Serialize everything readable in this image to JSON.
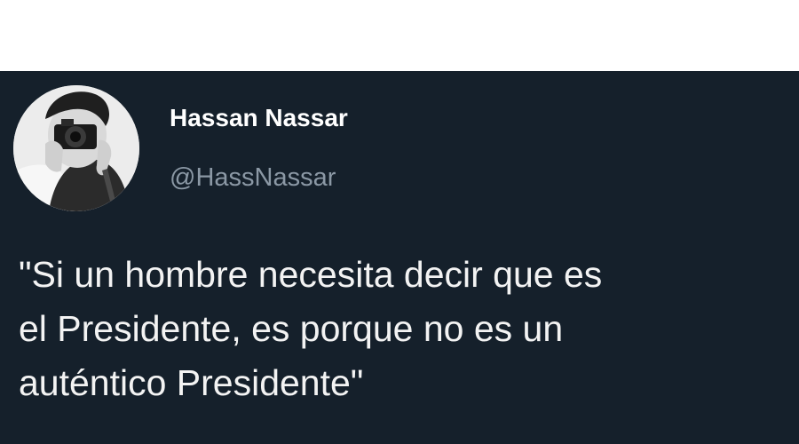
{
  "tweet": {
    "author_name": "Hassan Nassar",
    "author_handle": "@HassNassar",
    "text_lines": [
      "\"Si un hombre necesita decir que es",
      "el Presidente, es porque no es un",
      "auténtico Presidente\""
    ]
  },
  "colors": {
    "page_background": "#ffffff",
    "card_background": "#15202b",
    "name_color": "#ffffff",
    "handle_color": "#8b98a5",
    "text_color": "#f3f3f3"
  },
  "icons": {
    "avatar": "profile-photo"
  }
}
